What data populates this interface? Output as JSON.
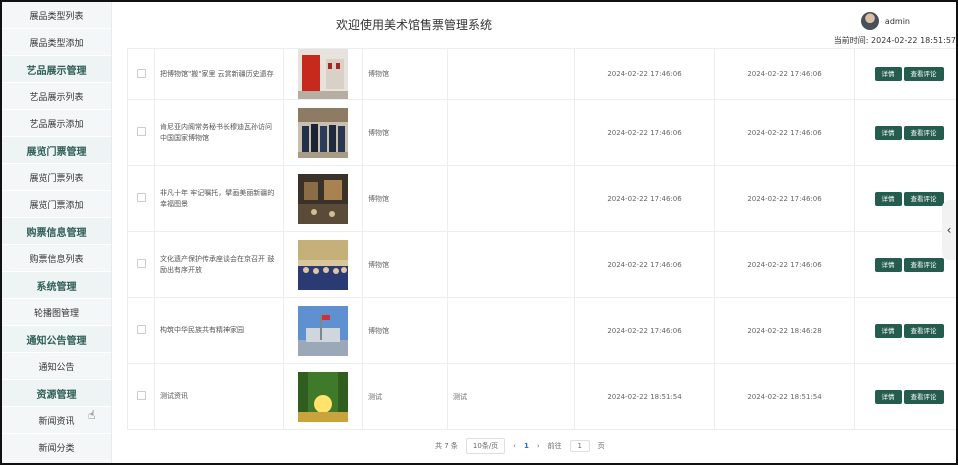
{
  "header": {
    "title": "欢迎使用美术馆售票管理系统",
    "username": "admin",
    "time_label": "当前时间:",
    "time_value": "2024-02-22 18:51:57"
  },
  "sidebar": {
    "items": [
      {
        "label": "展品类型列表",
        "type": "item"
      },
      {
        "label": "展品类型添加",
        "type": "item"
      },
      {
        "label": "艺品展示管理",
        "type": "group"
      },
      {
        "label": "艺品展示列表",
        "type": "item"
      },
      {
        "label": "艺品展示添加",
        "type": "item"
      },
      {
        "label": "展览门票管理",
        "type": "group"
      },
      {
        "label": "展览门票列表",
        "type": "item"
      },
      {
        "label": "展览门票添加",
        "type": "item"
      },
      {
        "label": "购票信息管理",
        "type": "group"
      },
      {
        "label": "购票信息列表",
        "type": "item"
      },
      {
        "label": "系统管理",
        "type": "group"
      },
      {
        "label": "轮播图管理",
        "type": "item"
      },
      {
        "label": "通知公告管理",
        "type": "group"
      },
      {
        "label": "通知公告",
        "type": "item"
      },
      {
        "label": "资源管理",
        "type": "group"
      },
      {
        "label": "新闻资讯",
        "type": "item"
      },
      {
        "label": "新闻分类",
        "type": "item"
      }
    ]
  },
  "table": {
    "rows": [
      {
        "title": "把博物馆\"搬\"家里 云赏新疆历史遗存",
        "category": "博物馆",
        "content": "",
        "created": "2024-02-22 17:46:06",
        "updated": "2024-02-22 17:46:06",
        "thumb": "red-hall"
      },
      {
        "title": "肯尼亚内阁常务秘书长穆迪瓦孙访问中国国家博物馆",
        "category": "博物馆",
        "content": "",
        "created": "2024-02-22 17:46:06",
        "updated": "2024-02-22 17:46:06",
        "thumb": "people-line"
      },
      {
        "title": "非凡十年 牢记嘱托，擘画美丽新疆的幸福图景",
        "category": "博物馆",
        "content": "",
        "created": "2024-02-22 17:46:06",
        "updated": "2024-02-22 17:46:06",
        "thumb": "exhibit-hall"
      },
      {
        "title": "文化遗产保护传承座谈会在京召开 鼓励出有序开放",
        "category": "博物馆",
        "content": "",
        "created": "2024-02-22 17:46:06",
        "updated": "2024-02-22 17:46:06",
        "thumb": "meeting"
      },
      {
        "title": "构筑中华民族共有精神家园",
        "category": "博物馆",
        "content": "",
        "created": "2024-02-22 17:46:06",
        "updated": "2024-02-22 18:46:28",
        "thumb": "building"
      },
      {
        "title": "测试资讯",
        "category": "测试",
        "content": "测试",
        "created": "2024-02-22 18:51:54",
        "updated": "2024-02-22 18:51:54",
        "thumb": "sunset-trees"
      }
    ],
    "btn_detail": "详情",
    "btn_comments": "查看评论"
  },
  "pagination": {
    "total_text": "共 7 条",
    "page_size": "10条/页",
    "prev": "‹",
    "current": "1",
    "next": "›",
    "goto_label": "前往",
    "goto_value": "1",
    "page_unit": "页"
  },
  "colors": {
    "accent": "#245c4e",
    "group_text": "#2f5f56"
  }
}
